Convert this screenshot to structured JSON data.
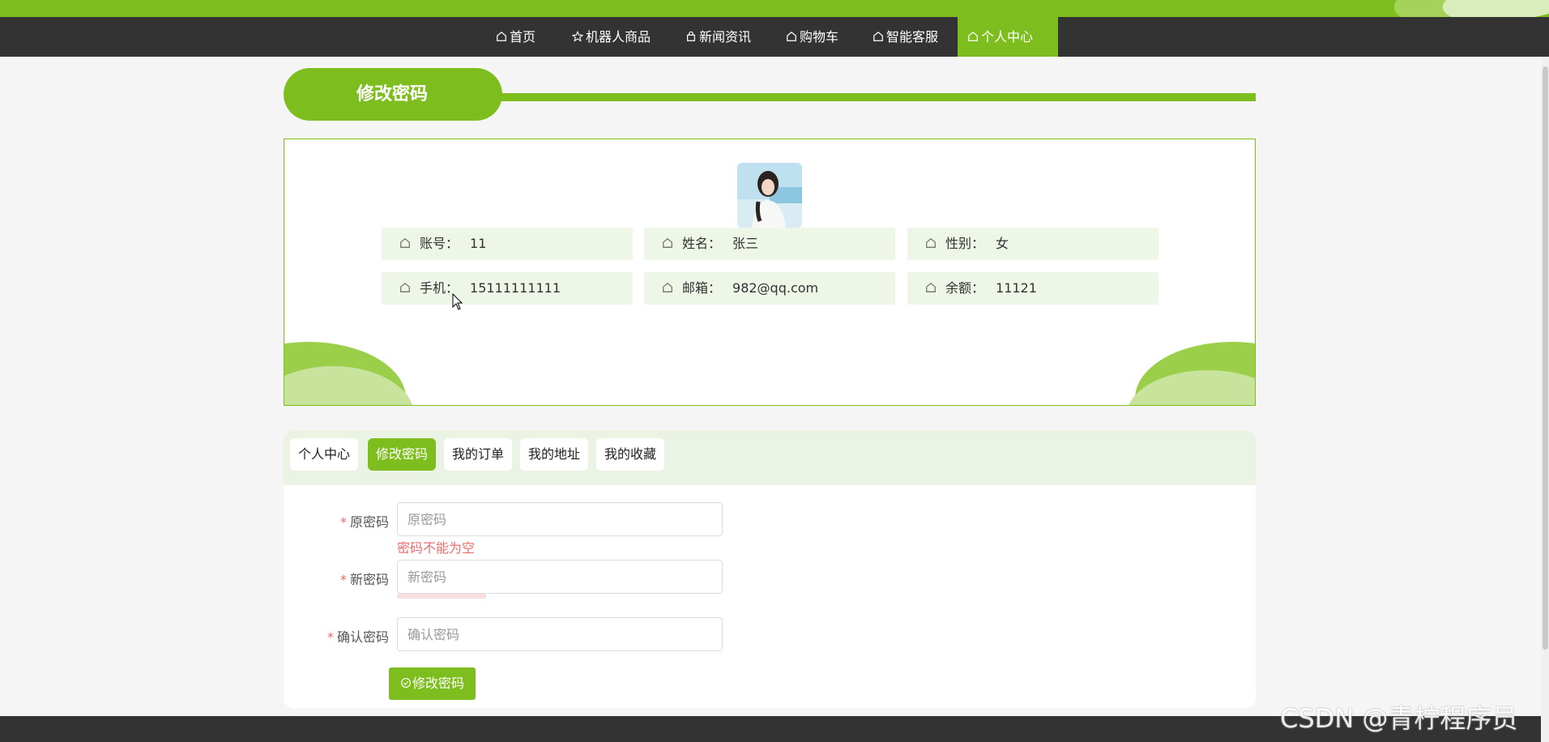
{
  "nav": {
    "items": [
      {
        "label": "首页",
        "icon": "home-icon"
      },
      {
        "label": "机器人商品",
        "icon": "star-icon"
      },
      {
        "label": "新闻资讯",
        "icon": "bag-icon"
      },
      {
        "label": "购物车",
        "icon": "home-icon"
      },
      {
        "label": "智能客服",
        "icon": "home-icon"
      },
      {
        "label": "个人中心",
        "icon": "home-icon",
        "active": true
      }
    ]
  },
  "page_title": "修改密码",
  "profile": {
    "avatar_icon": "user-avatar",
    "fields": [
      {
        "label": "账号：",
        "value": "11"
      },
      {
        "label": "姓名：",
        "value": "张三"
      },
      {
        "label": "性别：",
        "value": "女"
      },
      {
        "label": "手机：",
        "value": "15111111111"
      },
      {
        "label": "邮箱：",
        "value": "982@qq.com"
      },
      {
        "label": "余额：",
        "value": "11121"
      }
    ]
  },
  "tabs": [
    {
      "label": "个人中心"
    },
    {
      "label": "修改密码",
      "active": true
    },
    {
      "label": "我的订单"
    },
    {
      "label": "我的地址"
    },
    {
      "label": "我的收藏"
    }
  ],
  "form": {
    "old_password": {
      "label": "原密码",
      "placeholder": "原密码",
      "error": "密码不能为空"
    },
    "new_password": {
      "label": "新密码",
      "placeholder": "新密码"
    },
    "confirm_password": {
      "label": "确认密码",
      "placeholder": "确认密码"
    },
    "submit_label": "修改密码",
    "required_mark": "*"
  },
  "watermark": "CSDN @青柠程序员",
  "colors": {
    "accent": "#7dbe1e",
    "nav_bg": "#333333",
    "error": "#e86c6c",
    "cell_bg": "#eef6e8"
  }
}
